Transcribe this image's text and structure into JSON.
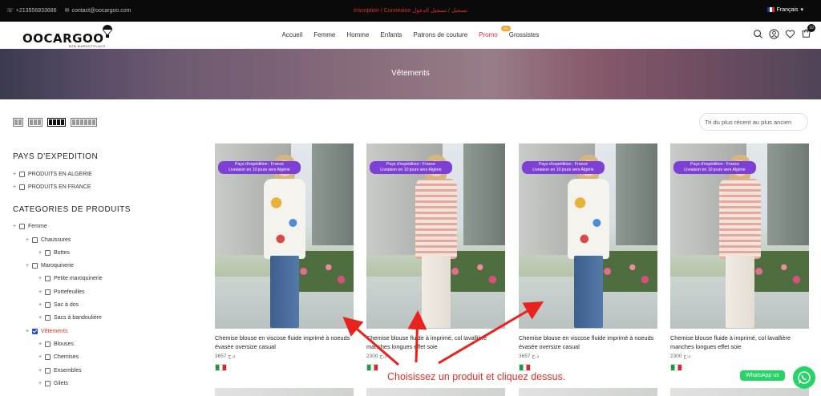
{
  "topbar": {
    "phone": "+213556833686",
    "email": "contact@oocargoo.com",
    "center_text": "Inscription / Connexion تسجيل / تسجيل الدخول",
    "language": "Français"
  },
  "header": {
    "logo": "OOCARGOO",
    "logo_sub": "B2B MARKETPLACE",
    "nav": [
      "Accueil",
      "Femme",
      "Homme",
      "Enfants",
      "Patrons de couture",
      "Promo",
      "Grossistes"
    ],
    "promo_badge": "5%",
    "cart_count": "10"
  },
  "hero": {
    "title": "Vêtements"
  },
  "toolbar": {
    "sort_value": "Tri du plus récent au plus ancien",
    "view_columns": [
      2,
      3,
      4,
      6
    ],
    "active_view": 4
  },
  "sidebar": {
    "shipping_title": "PAYS D'EXPEDITION",
    "shipping": [
      "PRODUITS EN ALGERIE",
      "PRODUITS EN FRANCE"
    ],
    "categories_title": "CATEGORIES DE PRODUITS",
    "categories": [
      {
        "label": "Femme",
        "level": 0,
        "checked": false
      },
      {
        "label": "Chaussures",
        "level": 1,
        "checked": false
      },
      {
        "label": "Bottes",
        "level": 2,
        "checked": false
      },
      {
        "label": "Maroquinerie",
        "level": 1,
        "checked": false
      },
      {
        "label": "Petite maroquinerie",
        "level": 2,
        "checked": false
      },
      {
        "label": "Portefeuilles",
        "level": 2,
        "checked": false
      },
      {
        "label": "Sac à dos",
        "level": 2,
        "checked": false
      },
      {
        "label": "Sacs à bandoulière",
        "level": 2,
        "checked": false
      },
      {
        "label": "Vêtements",
        "level": 1,
        "checked": true
      },
      {
        "label": "Blouses",
        "level": 2,
        "checked": false
      },
      {
        "label": "Chemises",
        "level": 2,
        "checked": false
      },
      {
        "label": "Ensembles",
        "level": 2,
        "checked": false
      },
      {
        "label": "Gilets",
        "level": 2,
        "checked": false
      }
    ]
  },
  "products": [
    {
      "badge_line1": "Pays d'expédition : France",
      "badge_line2": "Livraison en 10 jours vers Algérie",
      "name": "Chemise blouse en viscose fluide imprimé à noeuds évasée oversize casual",
      "price": "3657 د.ج",
      "style": "print"
    },
    {
      "badge_line1": "Pays d'expédition : France",
      "badge_line2": "Livraison en 10 jours vers Algérie",
      "name": "Chemise blouse fluide à imprimé, col lavallière manches longues effet soie",
      "price": "2300 د.ج",
      "style": "check"
    },
    {
      "badge_line1": "Pays d'expédition : France",
      "badge_line2": "Livraison en 10 jours vers Algérie",
      "name": "Chemise blouse en viscose fluide imprimé à noeuds évasée oversize casual",
      "price": "3657 د.ج",
      "style": "print"
    },
    {
      "badge_line1": "Pays d'expédition : France",
      "badge_line2": "Livraison en 10 jours vers Algérie",
      "name": "Chemise blouse fluide à imprimé, col lavallière manches longues effet soie",
      "price": "2300 د.ج",
      "style": "check"
    }
  ],
  "annotation": {
    "text": "Choisissez un produit et cliquez dessus."
  },
  "whatsapp": {
    "label": "WhatsApp us"
  }
}
